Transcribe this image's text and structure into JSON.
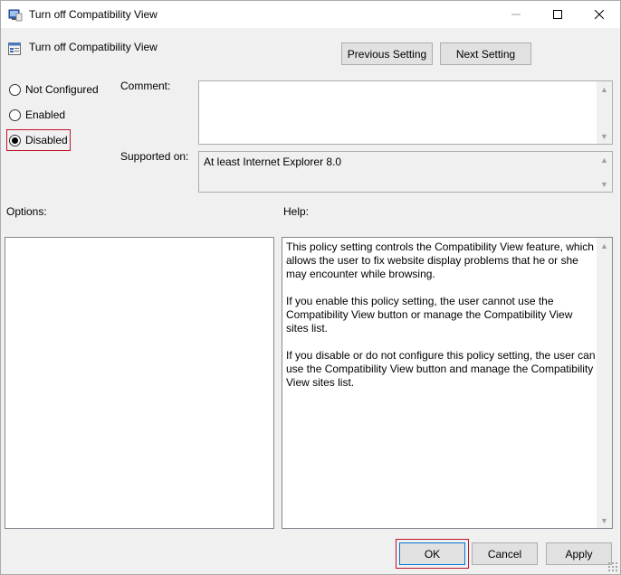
{
  "window": {
    "title": "Turn off Compatibility View",
    "icon": "policy-editor-icon"
  },
  "header": {
    "policy_name": "Turn off Compatibility View",
    "prev_label": "Previous Setting",
    "next_label": "Next Setting"
  },
  "state": {
    "options": [
      {
        "label": "Not Configured",
        "checked": false
      },
      {
        "label": "Enabled",
        "checked": false
      },
      {
        "label": "Disabled",
        "checked": true
      }
    ]
  },
  "labels": {
    "comment": "Comment:",
    "supported_on": "Supported on:",
    "options": "Options:",
    "help": "Help:"
  },
  "comment": {
    "value": ""
  },
  "supported": {
    "value": "At least Internet Explorer 8.0"
  },
  "help": {
    "paragraphs": [
      "This policy setting controls the Compatibility View feature, which allows the user to fix website display problems that he or she may encounter while browsing.",
      "If you enable this policy setting, the user cannot use the Compatibility View button or manage the Compatibility View sites list.",
      "If you disable or do not configure this policy setting, the user can use the Compatibility View button and manage the Compatibility View sites list."
    ]
  },
  "footer": {
    "ok_label": "OK",
    "cancel_label": "Cancel",
    "apply_label": "Apply"
  },
  "colors": {
    "highlight": "#c0142b",
    "accent": "#0078d7"
  }
}
